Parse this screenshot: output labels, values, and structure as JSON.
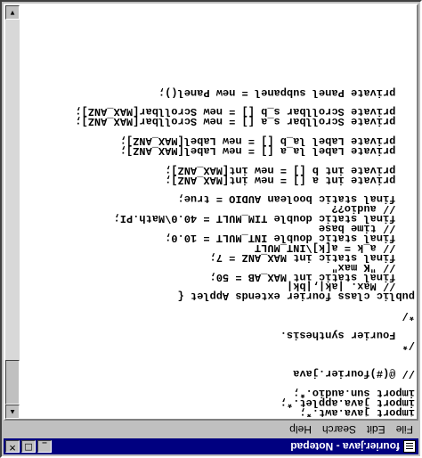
{
  "window": {
    "title": "fourier.java - Notepad",
    "buttons": {
      "minimize": "_",
      "maximize": "□",
      "close": "✕"
    }
  },
  "menu": [
    "File",
    "Edit",
    "Search",
    "Help"
  ],
  "editor": {
    "lines": [
      "import java.awt.*;",
      "import java.applet.*;",
      "import sun.audio.*;",
      "",
      "// @(#)fourier.java",
      "",
      "",
      "/*",
      "   Fourier synthesis.",
      "",
      "*/",
      "",
      "public class fourier extends Applet {",
      "   // Max. |ak|,|bk|",
      "   final static int MAX_AB = 50;",
      "   // \"K max\"",
      "   final static int MAX_ANZ = 7;",
      "   // a_k = a[k]\\INT_MULT",
      "   final static double INT_MULT = 10.0;",
      "   // time base",
      "   final static double TIM_MULT = 40.0\\Math.PI;",
      "   // audio??",
      "   final static boolean AUDIO = true;",
      "",
      "   private int a [] = new int[MAX_ANZ];",
      "   private int b [] = new int[MAX_ANZ];",
      "",
      "   private Label la_a [] = new Label[MAX_ANZ];",
      "   private Label la_b [] = new Label[MAX_ANZ];",
      "",
      "   private Scrollbar s_a [] = new Scrollbar[MAX_ANZ];",
      "   private Scrollbar s_b [] = new Scrollbar[MAX_ANZ];",
      "",
      "   private Panel subpanel = new Panel();",
      "",
      ""
    ]
  },
  "scrollbar": {
    "up_arrow": "▲",
    "down_arrow": "▼"
  }
}
